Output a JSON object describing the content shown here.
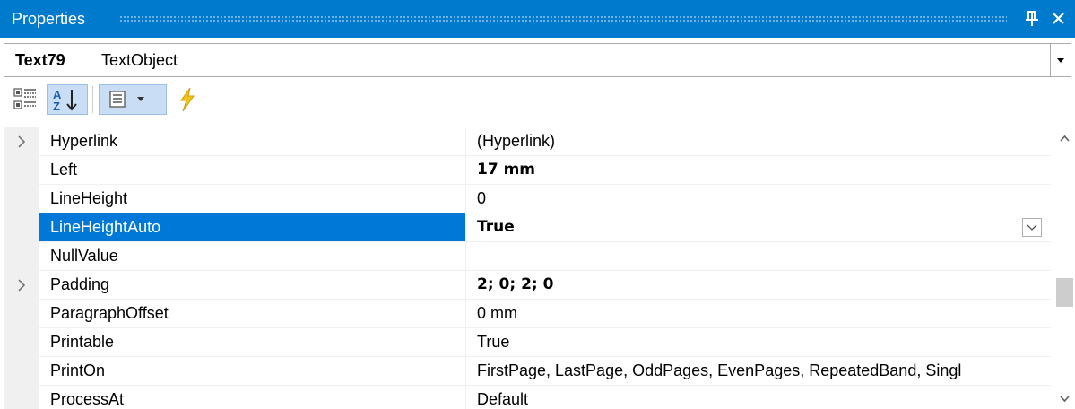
{
  "panel": {
    "title": "Properties",
    "pin_icon": "pin-icon",
    "close_icon": "close-icon",
    "accent_color": "#007acc"
  },
  "selector": {
    "object_name": "Text79",
    "object_type": "TextObject"
  },
  "toolbar": {
    "buttons": [
      {
        "icon": "categorized-icon",
        "active": false
      },
      {
        "icon": "alphabetical-sort-icon",
        "active": true
      },
      {
        "icon": "properties-icon",
        "active": true
      },
      {
        "icon": "events-lightning-icon",
        "active": false
      }
    ]
  },
  "properties": [
    {
      "name": "Hyperlink",
      "value": "(Hyperlink)",
      "expandable": true,
      "bold": false,
      "selected": false
    },
    {
      "name": "Left",
      "value": "17 mm",
      "expandable": false,
      "bold": true,
      "selected": false
    },
    {
      "name": "LineHeight",
      "value": "0",
      "expandable": false,
      "bold": false,
      "selected": false
    },
    {
      "name": "LineHeightAuto",
      "value": "True",
      "expandable": false,
      "bold": true,
      "selected": true
    },
    {
      "name": "NullValue",
      "value": "",
      "expandable": false,
      "bold": false,
      "selected": false
    },
    {
      "name": "Padding",
      "value": "2; 0; 2; 0",
      "expandable": true,
      "bold": true,
      "selected": false
    },
    {
      "name": "ParagraphOffset",
      "value": "0 mm",
      "expandable": false,
      "bold": false,
      "selected": false
    },
    {
      "name": "Printable",
      "value": "True",
      "expandable": false,
      "bold": false,
      "selected": false
    },
    {
      "name": "PrintOn",
      "value": "FirstPage, LastPage, OddPages, EvenPages, RepeatedBand, Singl",
      "expandable": false,
      "bold": false,
      "selected": false
    },
    {
      "name": "ProcessAt",
      "value": "Default",
      "expandable": false,
      "bold": false,
      "selected": false
    }
  ],
  "selection_color": "#0078d7"
}
